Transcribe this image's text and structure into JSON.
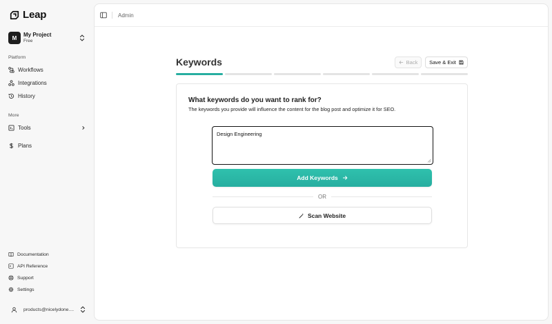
{
  "app": {
    "name": "Leap",
    "logo_icon": "leap-logo-icon"
  },
  "project": {
    "initial": "M",
    "name": "My Project",
    "plan": "Free"
  },
  "sidebar": {
    "platform_label": "Platform",
    "platform_items": [
      {
        "label": "Workflows",
        "icon": "workflow-icon"
      },
      {
        "label": "Integrations",
        "icon": "integrations-icon"
      },
      {
        "label": "History",
        "icon": "history-icon"
      }
    ],
    "more_label": "More",
    "more_items": [
      {
        "label": "Tools",
        "icon": "tools-icon"
      },
      {
        "label": "Plans",
        "icon": "dollar-icon"
      }
    ],
    "footer_items": [
      {
        "label": "Documentation",
        "icon": "book-icon"
      },
      {
        "label": "API Reference",
        "icon": "terminal-icon"
      },
      {
        "label": "Support",
        "icon": "lifebuoy-icon"
      },
      {
        "label": "Settings",
        "icon": "gear-icon"
      }
    ],
    "user_email": "products@nicelydone...."
  },
  "topbar": {
    "breadcrumb": "Admin"
  },
  "page": {
    "title": "Keywords",
    "back_label": "Back",
    "save_exit_label": "Save & Exit",
    "progress": {
      "total_steps": 6,
      "current_step": 1
    }
  },
  "card": {
    "question": "What keywords do you want to rank for?",
    "subtitle": "The keywords you provide will influence the content for the blog post and optimize it for SEO.",
    "input_value": "Design Engineering",
    "add_button_label": "Add Keywords",
    "or_label": "OR",
    "scan_button_label": "Scan Website"
  },
  "colors": {
    "accent": "#27aea0",
    "sidebar_bg": "#f7f7f7",
    "avatar_bg": "#1e1e1e"
  }
}
